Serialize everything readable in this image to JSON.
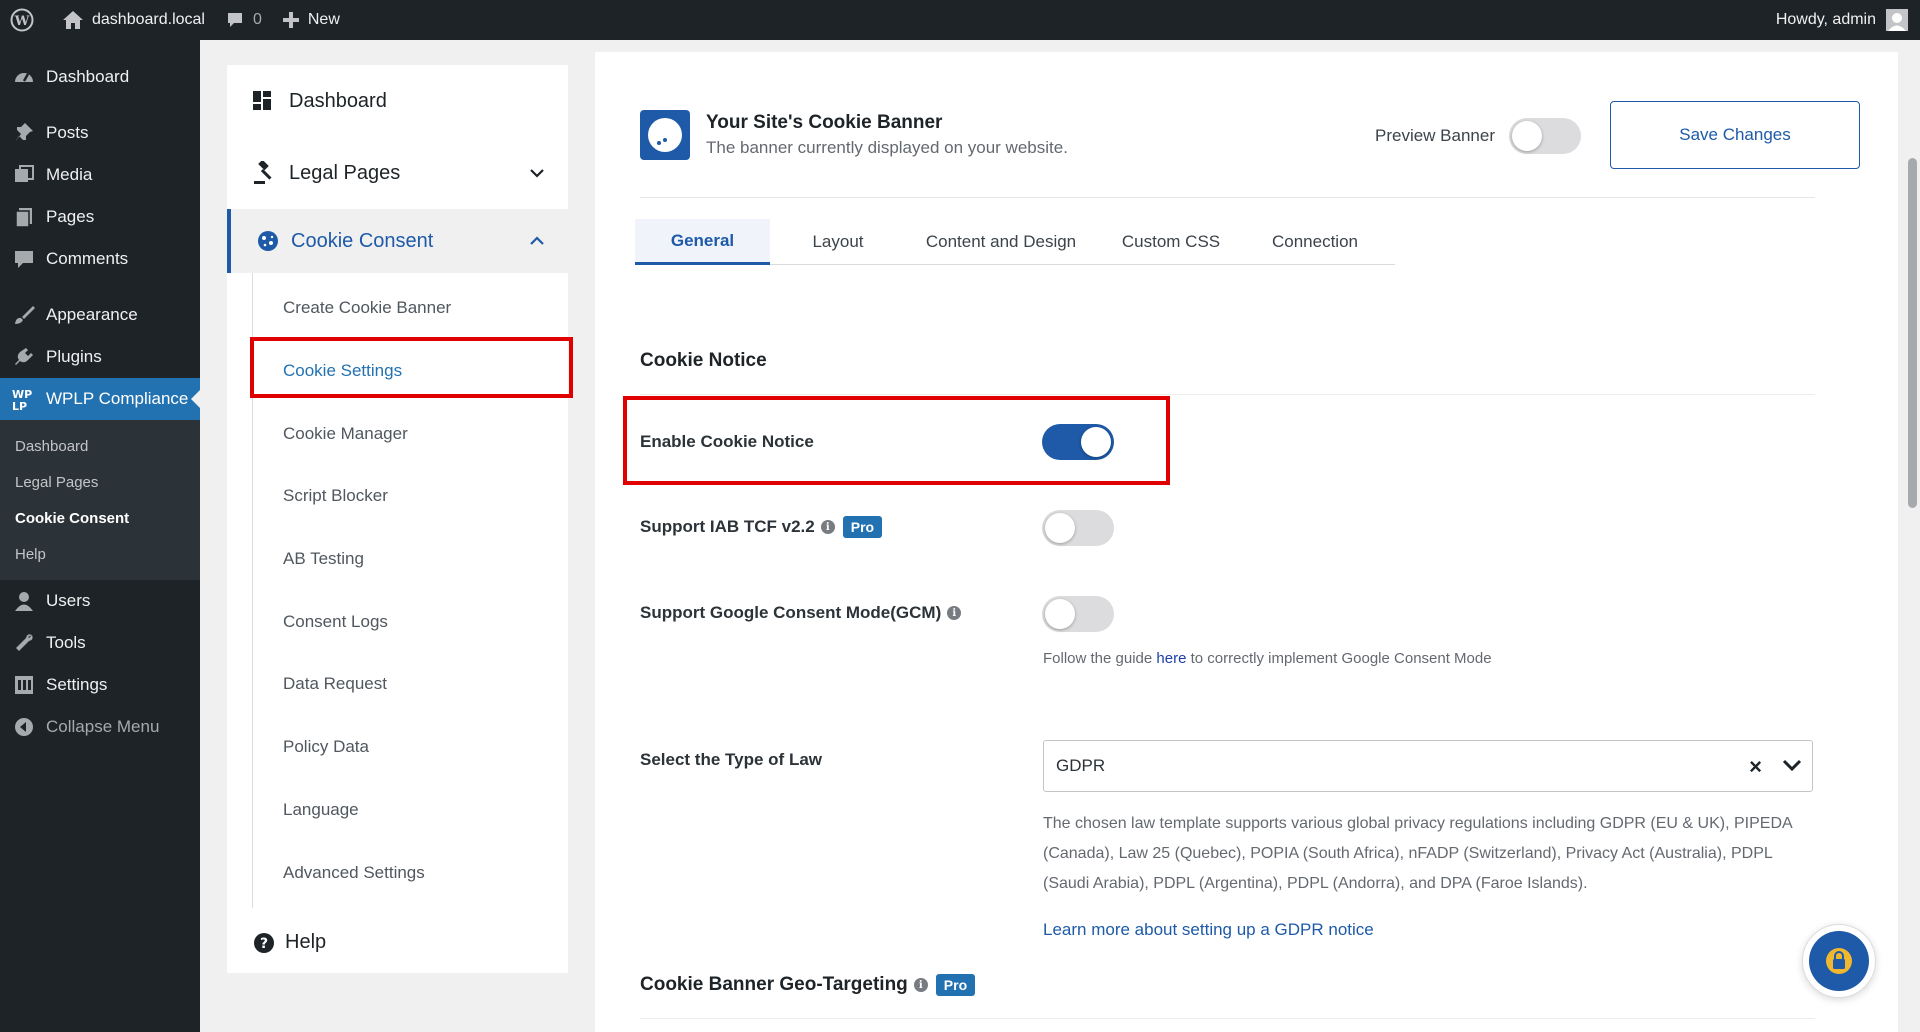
{
  "adminbar": {
    "site_name": "dashboard.local",
    "comments_count": "0",
    "new_label": "New",
    "howdy": "Howdy, admin"
  },
  "adminmenu": {
    "items": [
      {
        "label": "Dashboard",
        "icon": "dashboard-icon"
      },
      {
        "label": "Posts",
        "icon": "pin-icon"
      },
      {
        "label": "Media",
        "icon": "media-icon"
      },
      {
        "label": "Pages",
        "icon": "pages-icon"
      },
      {
        "label": "Comments",
        "icon": "comment-icon"
      },
      {
        "label": "Appearance",
        "icon": "brush-icon"
      },
      {
        "label": "Plugins",
        "icon": "plug-icon"
      },
      {
        "label": "WPLP Compliance",
        "icon": "wplp-logo-icon"
      }
    ],
    "submenu": [
      "Dashboard",
      "Legal Pages",
      "Cookie Consent",
      "Help"
    ],
    "lower_items": [
      {
        "label": "Users",
        "icon": "users-icon"
      },
      {
        "label": "Tools",
        "icon": "wrench-icon"
      },
      {
        "label": "Settings",
        "icon": "settings-icon"
      }
    ],
    "collapse": "Collapse Menu"
  },
  "plugin_sidebar": {
    "dashboard": "Dashboard",
    "legal_pages": "Legal Pages",
    "cookie_consent": "Cookie Consent",
    "sub_items": [
      "Create Cookie Banner",
      "Cookie Settings",
      "Cookie Manager",
      "Script Blocker",
      "AB Testing",
      "Consent Logs",
      "Data Request",
      "Policy Data",
      "Language",
      "Advanced Settings"
    ],
    "help": "Help"
  },
  "header": {
    "title": "Your Site's Cookie Banner",
    "subtitle": "The banner currently displayed on your website.",
    "preview_label": "Preview Banner",
    "save_label": "Save Changes"
  },
  "tabs": [
    "General",
    "Layout",
    "Content and Design",
    "Custom CSS",
    "Connection"
  ],
  "cookie_notice": {
    "section_title": "Cookie Notice",
    "enable_label": "Enable Cookie Notice",
    "iab_label": "Support IAB TCF v2.2",
    "gcm_label": "Support Google Consent Mode(GCM)",
    "pro_badge": "Pro",
    "guide_pre": "Follow the guide ",
    "guide_link": "here",
    "guide_post": " to correctly implement Google Consent Mode",
    "law_label": "Select the Type of Law",
    "law_value": "GDPR",
    "law_clear": "×",
    "law_desc": "The chosen law template supports various global privacy regulations including GDPR (EU & UK), PIPEDA (Canada), Law 25 (Quebec), POPIA (South Africa), nFADP (Switzerland), Privacy Act (Australia), PDPL (Saudi Arabia), PDPL (Argentina), PDPL (Andorra), and DPA (Faroe Islands).",
    "learn_more": "Learn more about setting up a GDPR notice",
    "info_glyph": "i"
  },
  "geo": {
    "title": "Cookie Banner Geo-Targeting",
    "pro_badge": "Pro"
  },
  "colors": {
    "accent": "#1e5aa8",
    "wp_blue": "#2271b1",
    "highlight_red": "#e00000",
    "admin_dark": "#1d2327"
  }
}
